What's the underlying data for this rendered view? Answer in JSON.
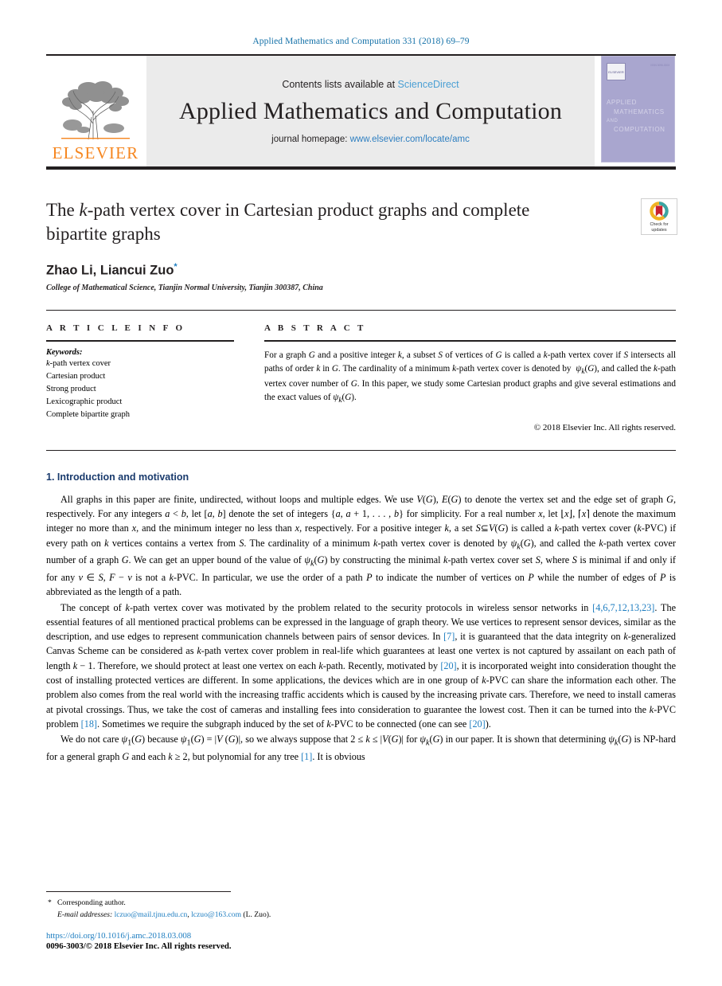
{
  "running_head": "Applied Mathematics and Computation 331 (2018) 69–79",
  "masthead": {
    "publisher_wordmark": "ELSEVIER",
    "contents_prefix": "Contents lists available at ",
    "contents_link": "ScienceDirect",
    "journal_title": "Applied Mathematics and Computation",
    "homepage_prefix": "journal homepage: ",
    "homepage_link": "www.elsevier.com/locate/amc",
    "cover": {
      "line1": "APPLIED",
      "line2": "MATHEMATICS",
      "line3": "AND",
      "line4": "COMPUTATION",
      "issn": "ISSN 0096-3003",
      "mini_logo": "ELSEVIER"
    },
    "colors": {
      "elsevier_orange": "#f6861f",
      "link_blue": "#2e7fc1",
      "band_grey": "#ebebeb",
      "cover_purple": "#a9a6cf"
    }
  },
  "article": {
    "title_line1_a": "The ",
    "title_line1_k": "k",
    "title_line1_b": "-path vertex cover in Cartesian product graphs and",
    "title_line2": "complete bipartite graphs",
    "authors": "Zhao Li, Liancui Zuo",
    "corresponding_marker": "*",
    "affiliation": "College of Mathematical Science, Tianjin Normal University, Tianjin 300387, China",
    "crossmark_label_line1": "Check for",
    "crossmark_label_line2": "updates"
  },
  "article_info": {
    "heading": "A R T I C L E   I N F O",
    "keywords_label": "Keywords:",
    "keywords": [
      "k-path vertex cover",
      "Cartesian product",
      "Strong product",
      "Lexicographic product",
      "Complete bipartite graph"
    ]
  },
  "abstract": {
    "heading": "A B S T R A C T",
    "text": "For a graph G and a positive integer k, a subset S of vertices of G is called a k-path vertex cover if S intersects all paths of order k in G. The cardinality of a minimum k-path vertex cover is denoted by ψk(G), and called the k-path vertex cover number of G. In this paper, we study some Cartesian product graphs and give several estimations and the exact values of ψk(G).",
    "copyright": "© 2018 Elsevier Inc. All rights reserved."
  },
  "body": {
    "section_number": "1.",
    "section_title": "1. Introduction and motivation",
    "paragraph1": "All graphs in this paper are finite, undirected, without loops and multiple edges. We use V(G), E(G) to denote the vertex set and the edge set of graph G, respectively. For any integers a < b, let [a, b] denote the set of integers {a, a + 1, . . . , b} for simplicity. For a real number x, let ⌊x⌋, ⌈x⌉ denote the maximum integer no more than x, and the minimum integer no less than x, respectively. For a positive integer k, a set S⊆V(G) is called a k-path vertex cover (k-PVC) if every path on k vertices contains a vertex from S. The cardinality of a minimum k-path vertex cover is denoted by ψk(G), and called the k-path vertex cover number of a graph G. We can get an upper bound of the value of ψk(G) by constructing the minimal k-path vertex cover set S, where S is minimal if and only if for any v ∈ S, F − v is not a k-PVC. In particular, we use the order of a path P to indicate the number of vertices on P while the number of edges of P is abbreviated as the length of a path.",
    "paragraph2_a": "The concept of k-path vertex cover was motivated by the problem related to the security protocols in wireless sensor networks in ",
    "paragraph2_ref1": "[4,6,7,12,13,23]",
    "paragraph2_b": ". The essential features of all mentioned practical problems can be expressed in the language of graph theory. We use vertices to represent sensor devices, similar as the description, and use edges to represent communication channels between pairs of sensor devices. In ",
    "paragraph2_ref2": "[7]",
    "paragraph2_c": ", it is guaranteed that the data integrity on k-generalized Canvas Scheme can be considered as k-path vertex cover problem in real-life which guarantees at least one vertex is not captured by assailant on each path of length k − 1. Therefore, we should protect at least one vertex on each k-path. Recently, motivated by ",
    "paragraph2_ref3": "[20]",
    "paragraph2_d": ", it is incorporated weight into consideration thought the cost of installing protected vertices are different. In some applications, the devices which are in one group of k-PVC can share the information each other. The problem also comes from the real world with the increasing traffic accidents which is caused by the increasing private cars. Therefore, we need to install cameras at pivotal crossings. Thus, we take the cost of cameras and installing fees into consideration to guarantee the lowest cost. Then it can be turned into the k-PVC problem ",
    "paragraph2_ref4": "[18]",
    "paragraph2_e": ". Sometimes we require the subgraph induced by the set of k-PVC to be connected (one can see ",
    "paragraph2_ref5": "[20]",
    "paragraph2_f": ").",
    "paragraph3_a": "We do not care ψ1(G) because ψ1(G) = |V(G)|, so we always suppose that 2 ≤ k ≤ |V(G)| for ψk(G) in our paper. It is shown that determining ψk(G) is NP-hard for a general graph G and each k ≥ 2, but polynomial for any tree ",
    "paragraph3_ref1": "[1]",
    "paragraph3_b": ". It is obvious"
  },
  "footer": {
    "corresponding_star": "*",
    "corresponding_text": "Corresponding author.",
    "email_label": "E-mail addresses:",
    "email1": "lczuo@mail.tjnu.edu.cn",
    "email_sep": ", ",
    "email2": "lczuo@163.com",
    "email_suffix": " (L. Zuo).",
    "doi": "https://doi.org/10.1016/j.amc.2018.03.008",
    "issn_copyright": "0096-3003/© 2018 Elsevier Inc. All rights reserved."
  }
}
